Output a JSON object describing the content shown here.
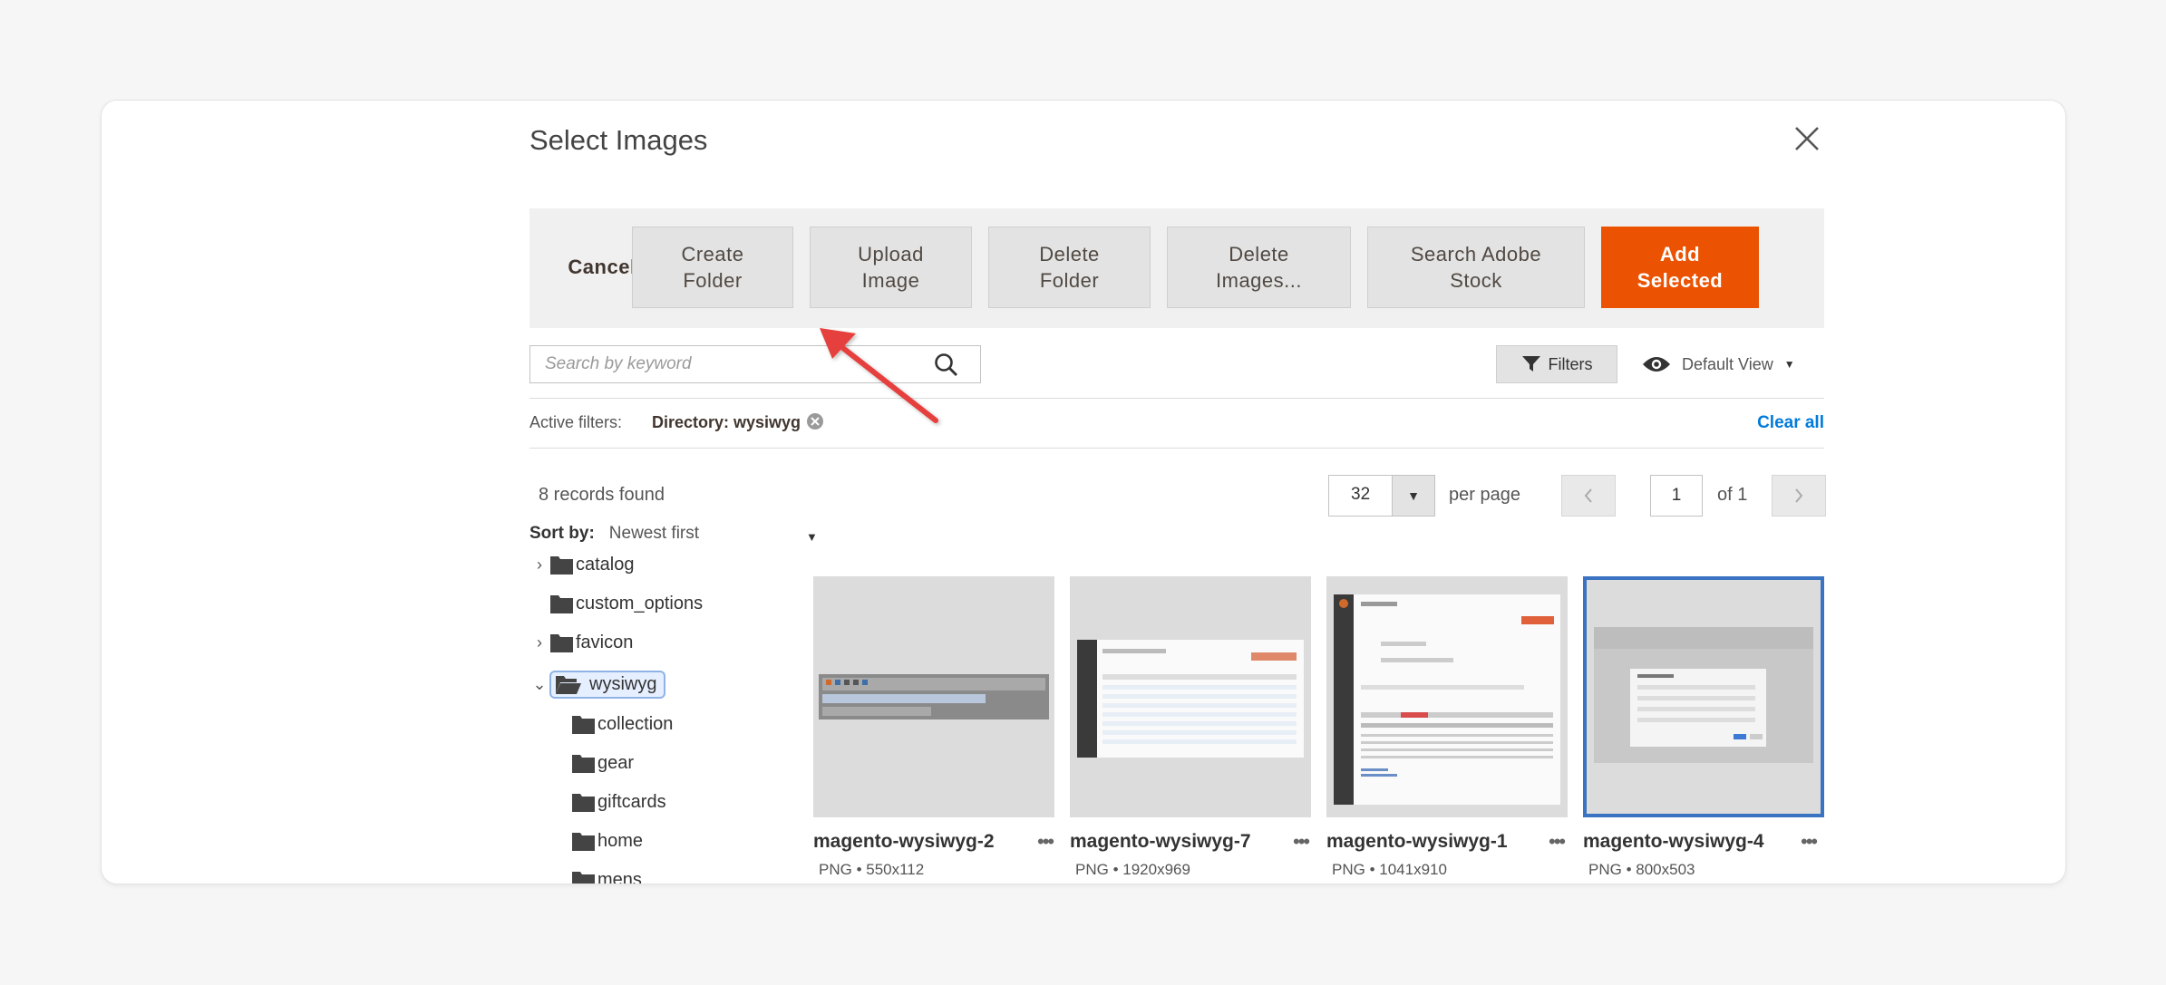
{
  "modal": {
    "title": "Select Images",
    "close_icon": "close-icon"
  },
  "toolbar": {
    "cancel_label": "Cancel",
    "create_folder_label": "Create\nFolder",
    "upload_image_label": "Upload\nImage",
    "delete_folder_label": "Delete\nFolder",
    "delete_images_label": "Delete\nImages...",
    "search_stock_label": "Search Adobe\nStock",
    "add_selected_label": "Add\nSelected",
    "accent_color": "#eb5202"
  },
  "search": {
    "placeholder": "Search by keyword",
    "icon": "search-icon"
  },
  "filters": {
    "button_label": "Filters",
    "icon": "funnel-icon"
  },
  "view": {
    "label": "Default View",
    "icon": "eye-icon"
  },
  "active_filters": {
    "label": "Active filters:",
    "chips": [
      "Directory: wysiwyg"
    ],
    "clear_all_label": "Clear all"
  },
  "listing": {
    "records_found": "8 records found",
    "per_page_value": "32",
    "per_page_label": "per page",
    "page_current": "1",
    "page_of": "of 1"
  },
  "sort": {
    "label": "Sort by:",
    "value": "Newest first"
  },
  "folders": [
    {
      "name": "catalog",
      "expandable": true,
      "level": 0
    },
    {
      "name": "custom_options",
      "expandable": false,
      "level": 0
    },
    {
      "name": "favicon",
      "expandable": true,
      "level": 0
    },
    {
      "name": "wysiwyg",
      "expandable": true,
      "expanded": true,
      "selected": true,
      "level": 0
    },
    {
      "name": "collection",
      "expandable": false,
      "level": 1
    },
    {
      "name": "gear",
      "expandable": false,
      "level": 1
    },
    {
      "name": "giftcards",
      "expandable": false,
      "level": 1
    },
    {
      "name": "home",
      "expandable": false,
      "level": 1
    },
    {
      "name": "mens",
      "expandable": false,
      "level": 1
    }
  ],
  "images": [
    {
      "name": "magento-wysiwyg-2",
      "type": "PNG",
      "size": "550x112",
      "selected": false
    },
    {
      "name": "magento-wysiwyg-7",
      "type": "PNG",
      "size": "1920x969",
      "selected": false
    },
    {
      "name": "magento-wysiwyg-1",
      "type": "PNG",
      "size": "1041x910",
      "selected": false
    },
    {
      "name": "magento-wysiwyg-4",
      "type": "PNG",
      "size": "800x503",
      "selected": true
    }
  ]
}
